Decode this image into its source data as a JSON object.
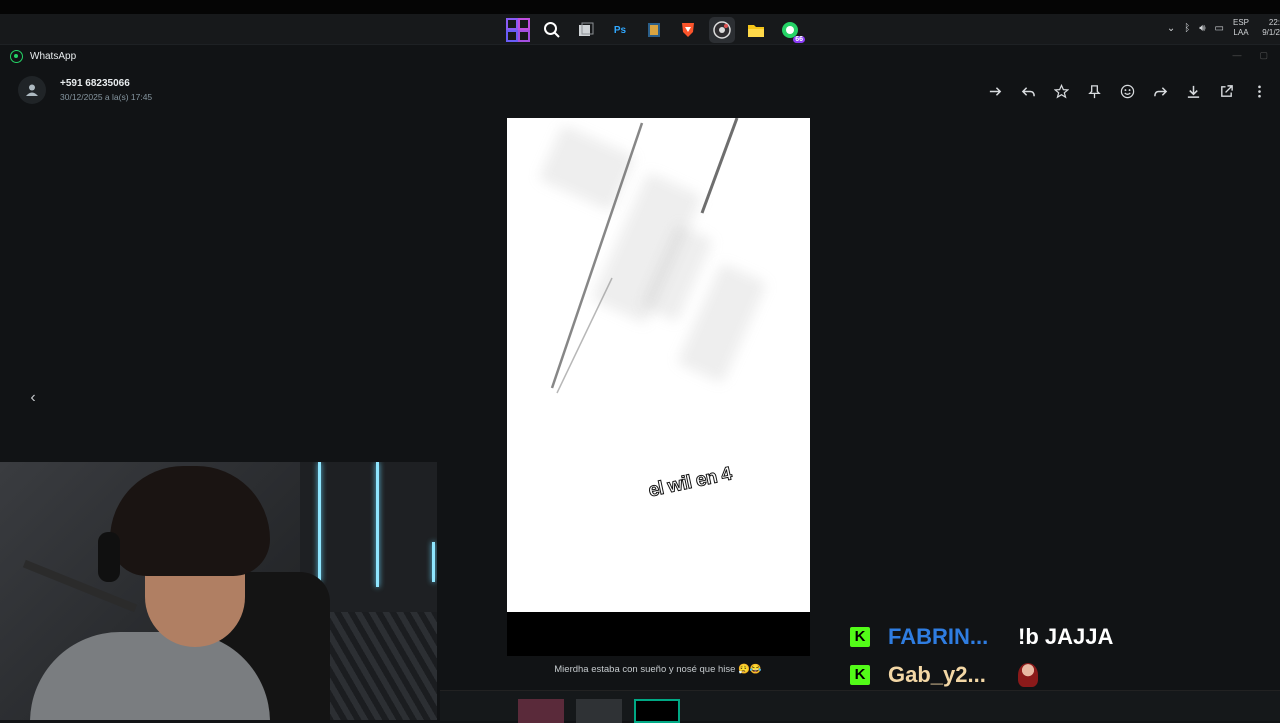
{
  "taskbar": {
    "icons": [
      "windows-start",
      "search",
      "task-view",
      "photoshop",
      "app",
      "brave",
      "obs",
      "file-explorer",
      "whatsapp"
    ],
    "photoshop_label": "Ps",
    "whatsapp_badge": "66",
    "lang_top": "ESP",
    "lang_bottom": "LAA",
    "clock_time": "22:",
    "clock_date": "9/1/2"
  },
  "app": {
    "title": "WhatsApp"
  },
  "viewer": {
    "sender": "+591 68235066",
    "timestamp": "30/12/2025 a la(s) 17:45",
    "overlay_text": "el wil en 4",
    "caption": "Mierdha estaba con sueño y nosé que hise 😮‍💨😂"
  },
  "chat": [
    {
      "platform_icon": "K",
      "user": "FABRIN...",
      "user_color": "#2f7de1",
      "message": "!b JAJJA"
    },
    {
      "platform_icon": "K",
      "user": "Gab_y2...",
      "user_color": "#f3d7a5",
      "message": ""
    }
  ],
  "colors": {
    "kick": "#53fc18",
    "whatsapp": "#25d366",
    "accent": "#00a884"
  }
}
